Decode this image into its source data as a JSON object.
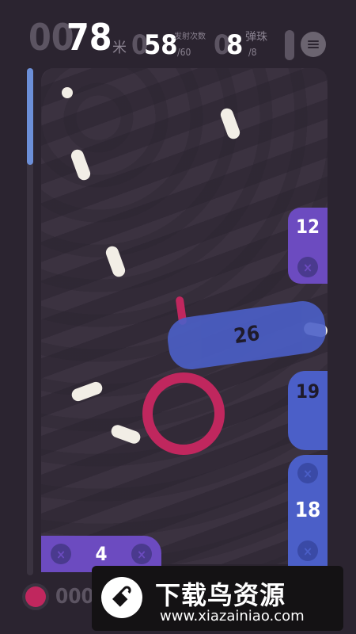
{
  "hud": {
    "distance_dim": "00",
    "distance_value": "78",
    "distance_unit": "米",
    "shots_dim": "0",
    "shots_value": "58",
    "shots_label": "发射次数",
    "shots_total": "/60",
    "balls_dim": "0",
    "balls_value": "8",
    "balls_label": "弹珠",
    "balls_total": "/8"
  },
  "progress": {
    "fraction": 0.19
  },
  "blocks": [
    {
      "value": "12",
      "color": "#6c4bc0"
    },
    {
      "value": "26",
      "color": "#4b5fc8"
    },
    {
      "value": "19",
      "color": "#4b5fc8"
    },
    {
      "value": "18",
      "color": "#4b5fc8"
    },
    {
      "value": "4",
      "color": "#6c4bc0"
    }
  ],
  "bottom": {
    "counter_value": "000"
  },
  "icons": {
    "menu": "menu-icon",
    "record": "record-icon",
    "block_x": "x-icon"
  },
  "watermark": {
    "title": "下载鸟资源",
    "url": "www.xiazainiao.com"
  },
  "colors": {
    "accent_pink": "#c0275e",
    "block_purple": "#6c4bc0",
    "block_blue": "#4b5fc8",
    "progress": "#6c8fd8"
  }
}
